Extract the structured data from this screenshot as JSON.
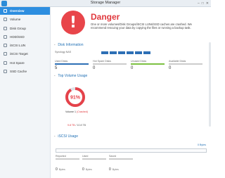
{
  "window": {
    "title": "Storage Manager",
    "min": "–",
    "max": "□",
    "close": "✕"
  },
  "sidebar": {
    "items": [
      {
        "label": "Overview",
        "icon": "overview-icon"
      },
      {
        "label": "Volume",
        "icon": "volume-icon"
      },
      {
        "label": "Disk Group",
        "icon": "disk-group-icon"
      },
      {
        "label": "HDD/SSD",
        "icon": "hdd-icon"
      },
      {
        "label": "iSCSI LUN",
        "icon": "iscsi-lun-icon"
      },
      {
        "label": "iSCSI Target",
        "icon": "iscsi-target-icon"
      },
      {
        "label": "Hot Spare",
        "icon": "hot-spare-icon"
      },
      {
        "label": "SSD Cache",
        "icon": "ssd-cache-icon"
      }
    ]
  },
  "status": {
    "title": "Danger",
    "message": "One or more volumes/Disk Groups/iSCSI LUNs/SSD caches are crashed. We recommend rescuing your data by copying the files or running a backup task.",
    "symbol": "!"
  },
  "disk_info": {
    "heading": "Disk Information",
    "row_label": "Synology NAS",
    "disk_bar_count": 6,
    "stats": [
      {
        "label": "Used Disks",
        "value": "5",
        "line_color": "#2d6fb5"
      },
      {
        "label": "Hot Spare Disks",
        "value": "0",
        "line_color": "#cccccc"
      },
      {
        "label": "Unused Disks",
        "value": "0",
        "line_color": "#7dc142"
      },
      {
        "label": "Available Disks",
        "value": "0",
        "line_color": "#cccccc"
      }
    ]
  },
  "top_volume": {
    "heading": "Top Volume Usage",
    "percent": 91,
    "percent_label": "91%",
    "volume_name": "Volume 1",
    "volume_status": "(Crashed)",
    "used": "9.8 TB",
    "separator": " / ",
    "total": "10.8 TB",
    "colors": {
      "used": "#e5424a",
      "free": "#dde2e7"
    }
  },
  "iscsi": {
    "heading": "iSCSI Usage",
    "count": "0 Bytes",
    "stats": [
      {
        "label": "Reported",
        "value": "0",
        "unit": "Bytes"
      },
      {
        "label": "Used",
        "value": "0",
        "unit": "Bytes"
      },
      {
        "label": "Saved",
        "value": "0",
        "unit": "Bytes"
      }
    ]
  },
  "colors": {
    "accent": "#2d8ee0",
    "danger": "#e0393e"
  }
}
